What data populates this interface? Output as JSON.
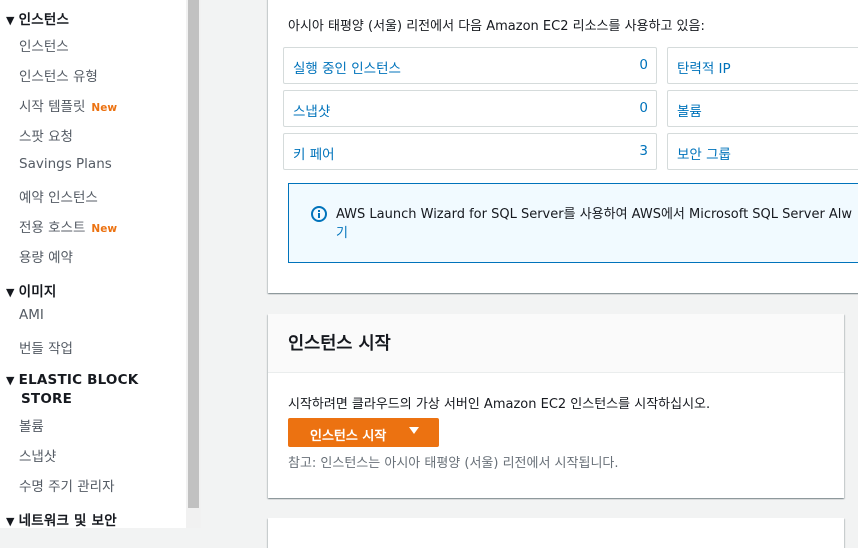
{
  "sidebar": {
    "instances_section": {
      "title": "인스턴스",
      "items": [
        {
          "label": "인스턴스"
        },
        {
          "label": "인스턴스 유형"
        },
        {
          "label": "시작 템플릿",
          "badge": "New"
        },
        {
          "label": "스팟 요청"
        },
        {
          "label": "Savings Plans"
        },
        {
          "label": "예약 인스턴스"
        },
        {
          "label": "전용 호스트",
          "badge": "New"
        },
        {
          "label": "용량 예약"
        }
      ]
    },
    "images_section": {
      "title": "이미지",
      "items": [
        {
          "label": "AMI"
        },
        {
          "label": "번들 작업"
        }
      ]
    },
    "ebs_section": {
      "title_line1": "ELASTIC BLOCK",
      "title_line2": "STORE",
      "items": [
        {
          "label": "볼륨"
        },
        {
          "label": "스냅샷"
        },
        {
          "label": "수명 주기 관리자"
        }
      ]
    },
    "network_section": {
      "title": "네트워크 및 보안"
    },
    "toggle_icon": "triangle-down-icon"
  },
  "resources": {
    "intro": "아시아 태평양 (서울) 리전에서 다음 Amazon EC2 리소스를 사용하고 있음:",
    "left_cards": [
      {
        "label": "실행 중인 인스턴스",
        "count": "0"
      },
      {
        "label": "스냅샷",
        "count": "0"
      },
      {
        "label": "키 페어",
        "count": "3"
      }
    ],
    "right_cards": [
      {
        "label": "탄력적 IP"
      },
      {
        "label": "볼륨"
      },
      {
        "label": "보안 그룹"
      }
    ],
    "info": {
      "icon": "info-icon",
      "text": "AWS Launch Wizard for SQL Server를 사용하여 AWS에서 Microsoft SQL Server Alw",
      "text_wrap": "기"
    }
  },
  "launch": {
    "title": "인스턴스 시작",
    "description": "시작하려면 클라우드의 가상 서버인 Amazon EC2 인스턴스를 시작하십시오.",
    "button_label": "인스턴스 시작",
    "note": "참고: 인스턴스는 아시아 태평양 (서울) 리전에서 시작됩니다."
  },
  "colors": {
    "accent": "#ec7211",
    "link": "#0073bb",
    "info_border": "#0073bb",
    "info_bg": "#f1faff"
  }
}
